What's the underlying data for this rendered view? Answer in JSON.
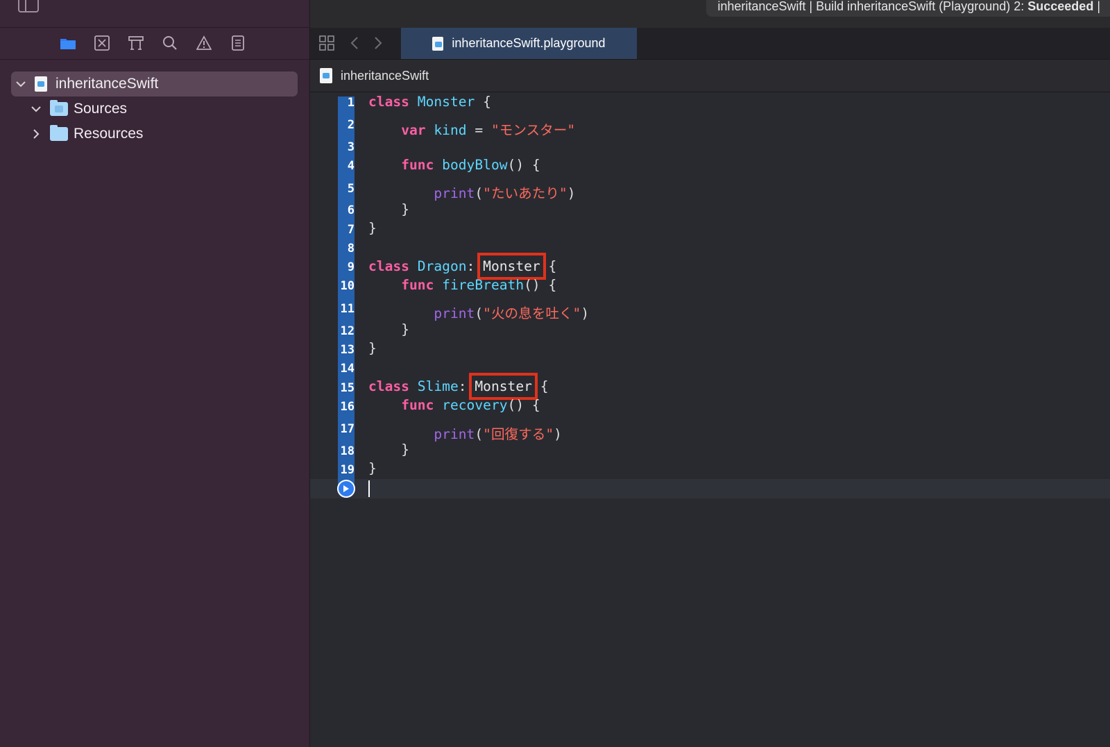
{
  "window": {
    "status_text": "inheritanceSwift | Build inheritanceSwift (Playground) 2: ",
    "status_result": "Succeeded",
    "status_tail": " |"
  },
  "navigator": {
    "tabs": [
      "folder-icon",
      "source-control-icon",
      "symbol-icon",
      "search-icon",
      "warning-icon",
      "report-icon"
    ],
    "project": "inheritanceSwift",
    "items": [
      {
        "label": "Sources",
        "expanded": true
      },
      {
        "label": "Resources",
        "expanded": false
      }
    ]
  },
  "editor": {
    "tab_label": "inheritanceSwift.playground",
    "jumpbar_label": "inheritanceSwift",
    "line_numbers": [
      "1",
      "2",
      "3",
      "4",
      "5",
      "6",
      "7",
      "8",
      "9",
      "10",
      "11",
      "12",
      "13",
      "14",
      "15",
      "16",
      "17",
      "18",
      "19"
    ],
    "code": {
      "l1_kw": "class",
      "l1_name": "Monster",
      "l1_rest": " {",
      "l2_kw": "var",
      "l2_name": "kind",
      "l2_op": " = ",
      "l2_str": "\"モンスター\"",
      "l4_kw": "func",
      "l4_name": "bodyBlow",
      "l4_rest": "() {",
      "l5_fn": "print",
      "l5_str": "\"たいあたり\"",
      "close_brace": "}",
      "l9_kw": "class",
      "l9_name": "Dragon",
      "colon": ":",
      "super": "Monster",
      "open_brace": " {",
      "l10_kw": "func",
      "l10_name": "fireBreath",
      "l10_rest": "() {",
      "l11_fn": "print",
      "l11_str": "\"火の息を吐く\"",
      "l15_kw": "class",
      "l15_name": "Slime",
      "l16_kw": "func",
      "l16_name": "recovery",
      "l16_rest": "() {",
      "l17_fn": "print",
      "l17_str": "\"回復する\"",
      "paren_open": "(",
      "paren_close": ")"
    }
  }
}
